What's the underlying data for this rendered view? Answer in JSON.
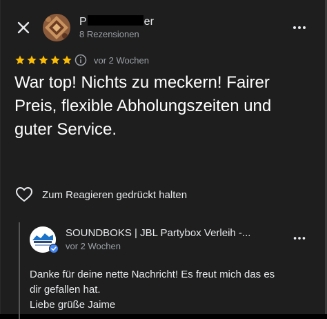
{
  "header": {
    "close_icon": "close-icon",
    "reviewer_name_start": "P",
    "reviewer_name_end": "er",
    "review_count": "8 Rezensionen",
    "more_icon": "more-vert-icon"
  },
  "review": {
    "rating": 5,
    "rating_max": 5,
    "star_color": "#fbbc04",
    "info_icon": "info-icon",
    "date": "vor 2 Wochen",
    "text": "War top! Nichts zu meckern! Fairer Preis, flexible Abholungszeiten und guter Service."
  },
  "reaction": {
    "icon": "heart-outline-icon",
    "label": "Zum Reagieren gedrückt halten"
  },
  "owner_reply": {
    "owner_name": "SOUNDBOKS | JBL Partybox Verleih -...",
    "date": "vor 2 Wochen",
    "verified_color": "#4285f4",
    "text_lines": [
      "Danke für deine nette Nachricht! Es freut mich das es",
      "dir gefallen hat.",
      "Liebe grüße Jaime"
    ]
  }
}
